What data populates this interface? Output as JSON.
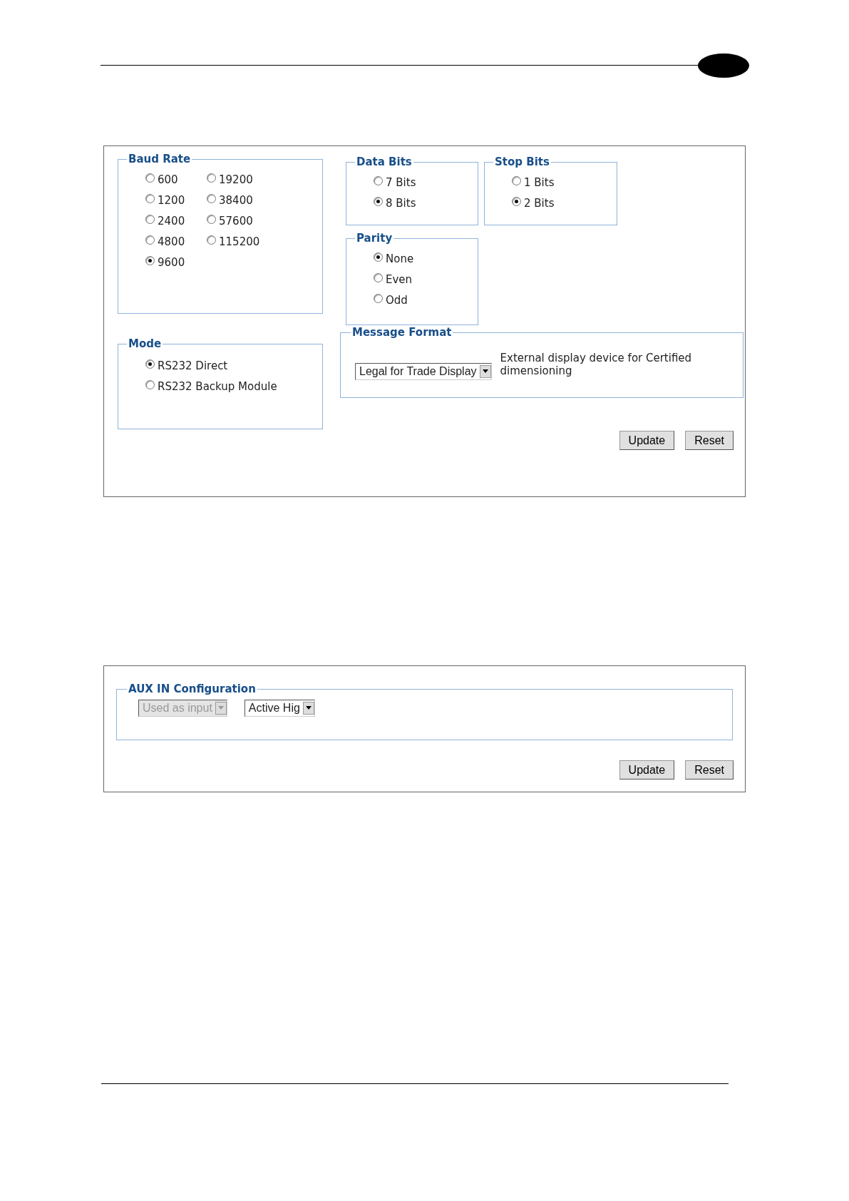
{
  "serial_panel": {
    "baud_rate": {
      "title": "Baud Rate",
      "options": [
        {
          "label": "600",
          "selected": false
        },
        {
          "label": "1200",
          "selected": false
        },
        {
          "label": "2400",
          "selected": false
        },
        {
          "label": "4800",
          "selected": false
        },
        {
          "label": "9600",
          "selected": true
        },
        {
          "label": "19200",
          "selected": false
        },
        {
          "label": "38400",
          "selected": false
        },
        {
          "label": "57600",
          "selected": false
        },
        {
          "label": "115200",
          "selected": false
        }
      ]
    },
    "data_bits": {
      "title": "Data Bits",
      "options": [
        {
          "label": "7 Bits",
          "selected": false
        },
        {
          "label": "8 Bits",
          "selected": true
        }
      ]
    },
    "stop_bits": {
      "title": "Stop Bits",
      "options": [
        {
          "label": "1 Bits",
          "selected": false
        },
        {
          "label": "2 Bits",
          "selected": true
        }
      ]
    },
    "parity": {
      "title": "Parity",
      "options": [
        {
          "label": "None",
          "selected": true
        },
        {
          "label": "Even",
          "selected": false
        },
        {
          "label": "Odd",
          "selected": false
        }
      ]
    },
    "mode": {
      "title": "Mode",
      "options": [
        {
          "label": "RS232 Direct",
          "selected": true
        },
        {
          "label": "RS232 Backup Module",
          "selected": false
        }
      ]
    },
    "message_format": {
      "title": "Message Format",
      "value": "Legal for Trade Display",
      "description": "External display device for Certified dimensioning"
    },
    "buttons": [
      "Update",
      "Reset"
    ]
  },
  "aux_panel": {
    "title": "AUX IN Configuration",
    "selects": [
      {
        "value": "Used as input",
        "disabled": true
      },
      {
        "value": "Active Hig",
        "disabled": false
      }
    ],
    "buttons": [
      "Update",
      "Reset"
    ]
  }
}
